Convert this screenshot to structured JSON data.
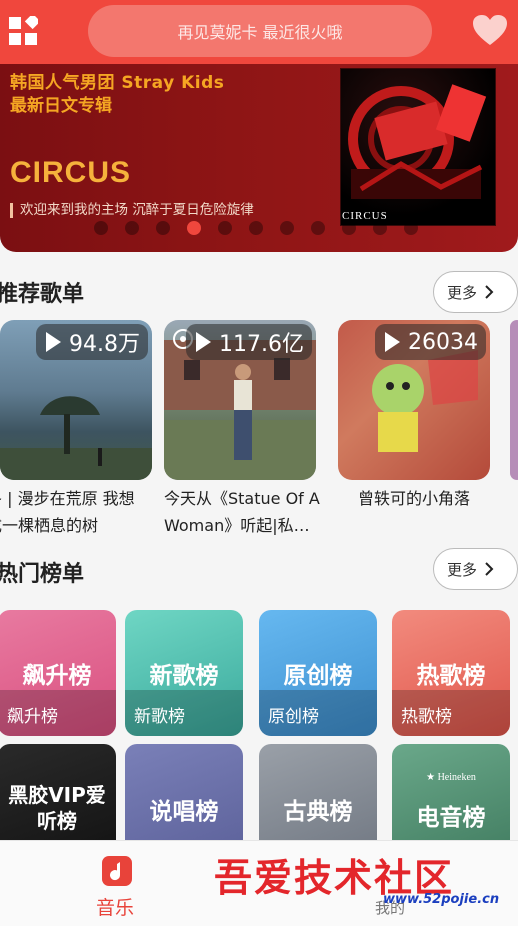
{
  "header": {
    "search_placeholder": "再见莫妮卡 最近很火哦",
    "accent": "#f0473d"
  },
  "banner": {
    "line1": "韩国人气男团 Stray Kids",
    "line2": "最新日文专辑",
    "title": "CIRCUS",
    "subtitle": "欢迎来到我的主场 沉醉于夏日危险旋律",
    "album_caption": "CIRCUS",
    "slide_count": 11,
    "active_index": 3
  },
  "recommend": {
    "title": "推荐歌单",
    "more": "更多",
    "items": [
      {
        "count": "94.8万",
        "name": "冬 | 漫步在荒原 我想成一棵栖息的树"
      },
      {
        "count": "117.6亿",
        "name": "今天从《Statue Of A Woman》听起|私…"
      },
      {
        "count": "26034",
        "name": "曾轶可的小角落"
      }
    ]
  },
  "charts": {
    "title": "热门榜单",
    "more": "更多",
    "tiles": [
      {
        "big": "飙升榜",
        "small": "飙升榜"
      },
      {
        "big": "新歌榜",
        "small": "新歌榜"
      },
      {
        "big": "原创榜",
        "small": "原创榜"
      },
      {
        "big": "热歌榜",
        "small": "热歌榜"
      },
      {
        "big": "黑胶VIP爱听榜",
        "small": ""
      },
      {
        "big": "说唱榜",
        "small": ""
      },
      {
        "big": "古典榜",
        "small": ""
      },
      {
        "big": "电音榜",
        "small": ""
      }
    ]
  },
  "bottom_nav": {
    "music": "音乐",
    "mine": "我的"
  },
  "watermark": {
    "text": "吾爱技术社区",
    "url": "www.52pojie.cn"
  }
}
